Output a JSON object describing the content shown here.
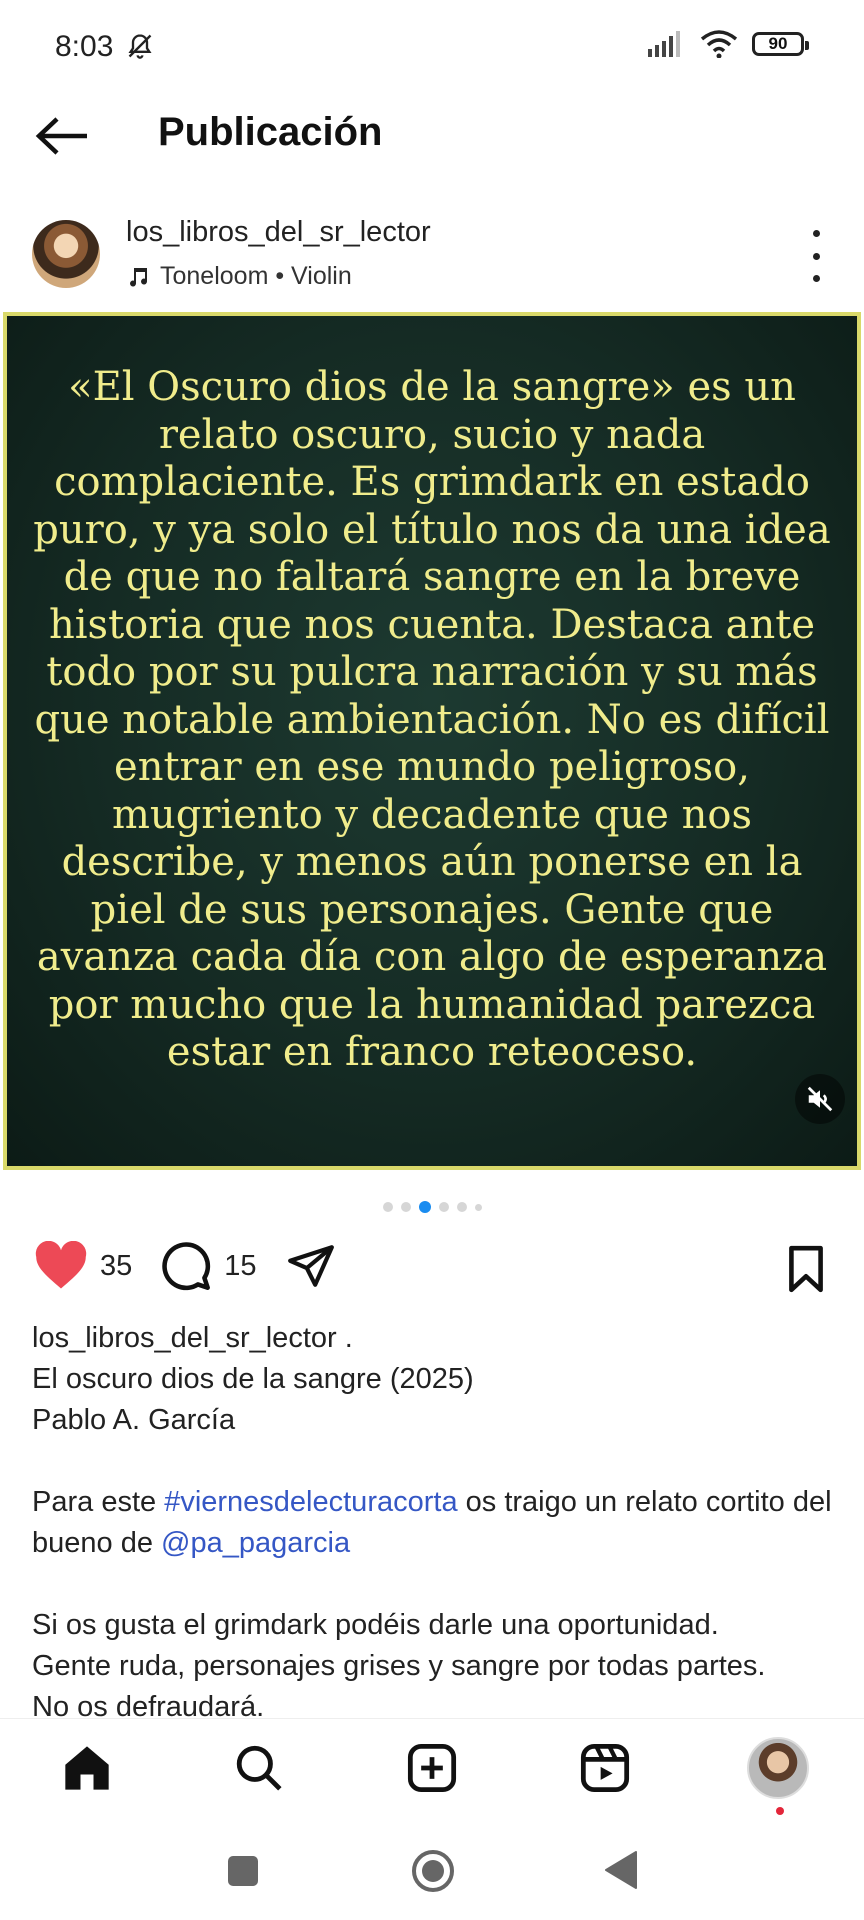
{
  "status_bar": {
    "time": "8:03",
    "battery": "90"
  },
  "header": {
    "title": "Publicación"
  },
  "post": {
    "username": "los_libros_del_sr_lector",
    "music": "Toneloom • Violin",
    "media_text": "«El Oscuro dios de la sangre» es un relato oscuro, sucio y nada complaciente. Es grimdark en estado puro, y ya solo el título nos da una idea de que no faltará sangre en la breve historia que nos cuenta. Destaca ante todo por su pulcra narración y su más que notable ambientación. No es difícil entrar en ese mundo peligroso, mugriento y decadente que nos describe, y menos aún ponerse en la piel de sus personajes. Gente que avanza cada día con algo de esperanza por mucho que la humanidad parezca estar en franco reteoceso.",
    "carousel": {
      "total": 6,
      "active": 3
    },
    "likes": "35",
    "comments": "15",
    "caption": {
      "username": "los_libros_del_sr_lector",
      "username_suffix": " .",
      "line1": "El oscuro dios de la sangre (2025)",
      "line2": "Pablo A. García",
      "p2_prefix": "Para este ",
      "hashtag": "#viernesdelecturacorta",
      "p2_middle": " os traigo un relato cortito del bueno de ",
      "mention": "@pa_pagarcia",
      "p3_line1": "Si os gusta el grimdark podéis darle una oportunidad.",
      "p3_line2": "Gente ruda, personajes grises y sangre por todas partes.",
      "p3_line3": "No os defraudará."
    }
  },
  "colors": {
    "like": "#ed4956",
    "link": "#3557c5",
    "media_text": "#f0ec8c",
    "media_bg": "#152b24",
    "carousel_active": "#1a8cf0"
  },
  "icons": [
    "silent-bell-icon",
    "signal-icon",
    "wifi-icon",
    "battery-icon",
    "back-arrow-icon",
    "music-note-icon",
    "more-options-icon",
    "muted-speaker-icon",
    "heart-icon",
    "comment-icon",
    "share-icon",
    "bookmark-icon",
    "home-icon",
    "search-icon",
    "create-icon",
    "reels-icon",
    "profile-avatar",
    "square-icon",
    "circle-icon",
    "triangle-back-icon"
  ]
}
